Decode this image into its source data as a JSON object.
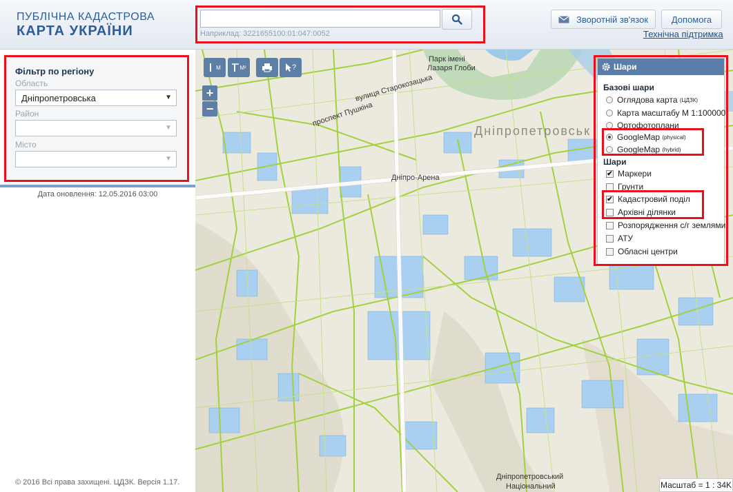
{
  "header": {
    "logo_line1": "ПУБЛІЧНА КАДАСТРОВА",
    "logo_line2": "КАРТА УКРАЇНИ",
    "search": {
      "value": "",
      "placeholder": "",
      "hint": "Наприклад: 3221655100:01:047:0052"
    },
    "feedback_label": "Зворотній зв'язок",
    "help_label": "Допомога",
    "support_label": "Технічна підтримка"
  },
  "sidebar": {
    "filter_title": "Фільтр по регіону",
    "oblast_label": "Область",
    "oblast_value": "Дніпропетровська",
    "rayon_label": "Район",
    "rayon_value": "",
    "misto_label": "Місто",
    "misto_value": "",
    "updated": "Дата оновлення: 12.05.2016 03:00",
    "copyright": "© 2016 Всі права захищені. ЦДЗК. Версія 1.17."
  },
  "map": {
    "toolbar": [
      {
        "name": "measure-length-button",
        "label": "М"
      },
      {
        "name": "measure-area-button",
        "label": "М²"
      },
      {
        "name": "print-button",
        "label": ""
      },
      {
        "name": "identify-button",
        "label": "?"
      }
    ],
    "zoom_in": "+",
    "zoom_out": "−",
    "labels": [
      {
        "text": "Парк імені"
      },
      {
        "text": "Лазаря Глоби"
      },
      {
        "text": "проспект Пушкіна"
      },
      {
        "text": "вулиця Старокозацька"
      },
      {
        "text": "Дніпропетровськ"
      },
      {
        "text": "Дніпро-Арена"
      },
      {
        "text": "Дніпропетровський"
      },
      {
        "text": "Національний"
      }
    ],
    "scale": "Масштаб = 1 : 34K"
  },
  "layers": {
    "title": "Шари",
    "base_title": "Базові шари",
    "base": [
      {
        "label": "Оглядова карта",
        "sup": "(ЦДЗК)",
        "selected": false
      },
      {
        "label": "Карта масштабу М 1:100000",
        "sup": "",
        "selected": false
      },
      {
        "label": "Ортофотоплани",
        "sup": "",
        "selected": false
      },
      {
        "label": "GoogleMap",
        "sup": "(physical)",
        "selected": true
      },
      {
        "label": "GoogleMap",
        "sup": "(hybrid)",
        "selected": false
      }
    ],
    "overlay_title": "Шари",
    "overlays": [
      {
        "label": "Маркери",
        "checked": true
      },
      {
        "label": "Грунти",
        "checked": false
      },
      {
        "label": "Кадастровий поділ",
        "checked": true
      },
      {
        "label": "Архівні ділянки",
        "checked": false
      },
      {
        "label": "Розпорядження с/г землями",
        "checked": false
      },
      {
        "label": "АТУ",
        "checked": false
      },
      {
        "label": "Обласні центри",
        "checked": false
      }
    ]
  },
  "colors": {
    "accent": "#2b5d9a",
    "highlight": "#e8101a",
    "panel_header": "#5a7ea8",
    "parcel_fill": "#a9d0f0",
    "parcel_line": "#9ccc3c"
  }
}
